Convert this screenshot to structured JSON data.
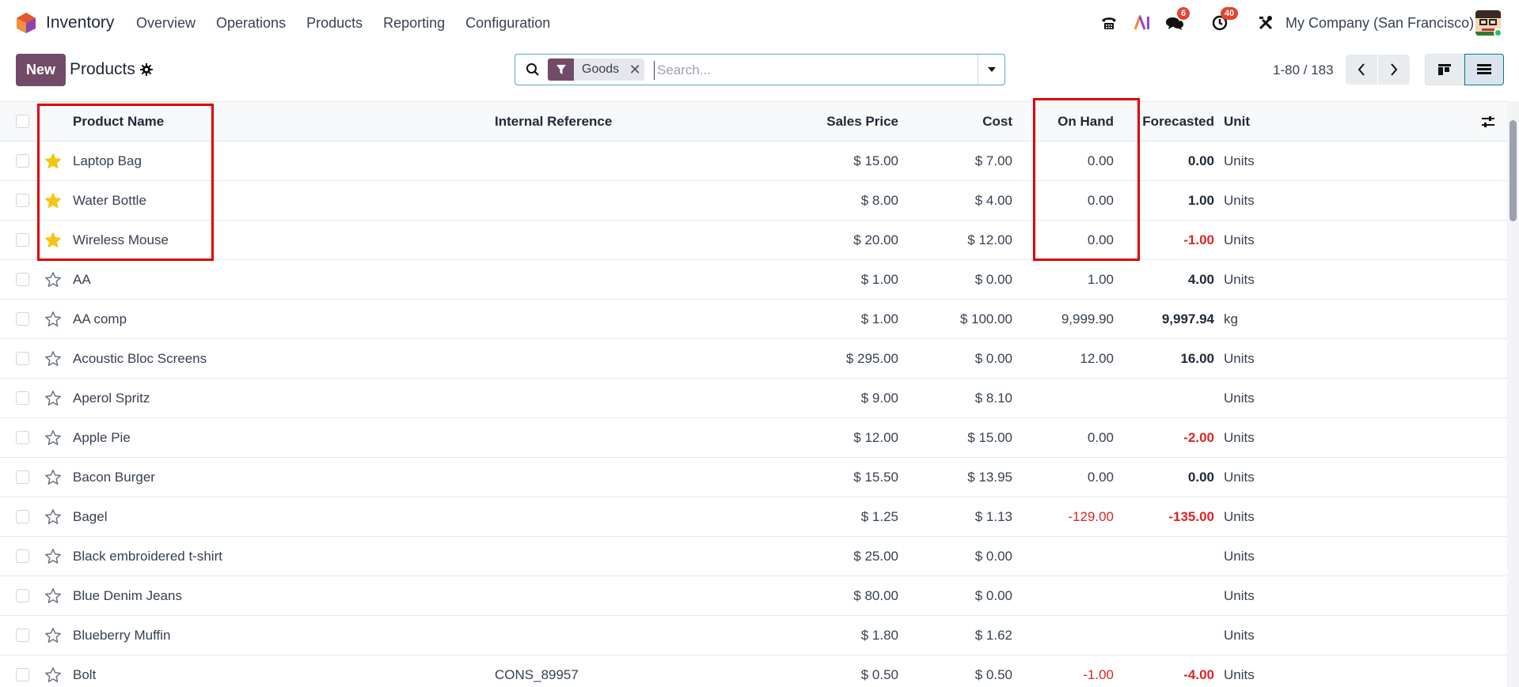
{
  "app": {
    "name": "Inventory"
  },
  "menu": [
    "Overview",
    "Operations",
    "Products",
    "Reporting",
    "Configuration"
  ],
  "systray": {
    "messages_count": "6",
    "activities_count": "40",
    "company": "My Company (San Francisco)"
  },
  "control": {
    "new_label": "New",
    "title": "Products",
    "facet_label": "Goods",
    "search_placeholder": "Search...",
    "pager": "1-80 / 183"
  },
  "columns": {
    "name": "Product Name",
    "ref": "Internal Reference",
    "price": "Sales Price",
    "cost": "Cost",
    "on_hand": "On Hand",
    "forecasted": "Forecasted",
    "unit": "Unit"
  },
  "rows": [
    {
      "starred": true,
      "name": "Laptop Bag",
      "ref": "",
      "price": "$ 15.00",
      "cost": "$ 7.00",
      "on_hand": "0.00",
      "forecasted": "0.00",
      "unit": "Units",
      "hand_neg": false,
      "fore_neg": false
    },
    {
      "starred": true,
      "name": "Water Bottle",
      "ref": "",
      "price": "$ 8.00",
      "cost": "$ 4.00",
      "on_hand": "0.00",
      "forecasted": "1.00",
      "unit": "Units",
      "hand_neg": false,
      "fore_neg": false
    },
    {
      "starred": true,
      "name": "Wireless Mouse",
      "ref": "",
      "price": "$ 20.00",
      "cost": "$ 12.00",
      "on_hand": "0.00",
      "forecasted": "-1.00",
      "unit": "Units",
      "hand_neg": false,
      "fore_neg": true
    },
    {
      "starred": false,
      "name": "AA",
      "ref": "",
      "price": "$ 1.00",
      "cost": "$ 0.00",
      "on_hand": "1.00",
      "forecasted": "4.00",
      "unit": "Units",
      "hand_neg": false,
      "fore_neg": false
    },
    {
      "starred": false,
      "name": "AA comp",
      "ref": "",
      "price": "$ 1.00",
      "cost": "$ 100.00",
      "on_hand": "9,999.90",
      "forecasted": "9,997.94",
      "unit": "kg",
      "hand_neg": false,
      "fore_neg": false
    },
    {
      "starred": false,
      "name": "Acoustic Bloc Screens",
      "ref": "",
      "price": "$ 295.00",
      "cost": "$ 0.00",
      "on_hand": "12.00",
      "forecasted": "16.00",
      "unit": "Units",
      "hand_neg": false,
      "fore_neg": false
    },
    {
      "starred": false,
      "name": "Aperol Spritz",
      "ref": "",
      "price": "$ 9.00",
      "cost": "$ 8.10",
      "on_hand": "",
      "forecasted": "",
      "unit": "Units",
      "hand_neg": false,
      "fore_neg": false
    },
    {
      "starred": false,
      "name": "Apple Pie",
      "ref": "",
      "price": "$ 12.00",
      "cost": "$ 15.00",
      "on_hand": "0.00",
      "forecasted": "-2.00",
      "unit": "Units",
      "hand_neg": false,
      "fore_neg": true
    },
    {
      "starred": false,
      "name": "Bacon Burger",
      "ref": "",
      "price": "$ 15.50",
      "cost": "$ 13.95",
      "on_hand": "0.00",
      "forecasted": "0.00",
      "unit": "Units",
      "hand_neg": false,
      "fore_neg": false
    },
    {
      "starred": false,
      "name": "Bagel",
      "ref": "",
      "price": "$ 1.25",
      "cost": "$ 1.13",
      "on_hand": "-129.00",
      "forecasted": "-135.00",
      "unit": "Units",
      "hand_neg": true,
      "fore_neg": true
    },
    {
      "starred": false,
      "name": "Black embroidered t-shirt",
      "ref": "",
      "price": "$ 25.00",
      "cost": "$ 0.00",
      "on_hand": "",
      "forecasted": "",
      "unit": "Units",
      "hand_neg": false,
      "fore_neg": false
    },
    {
      "starred": false,
      "name": "Blue Denim Jeans",
      "ref": "",
      "price": "$ 80.00",
      "cost": "$ 0.00",
      "on_hand": "",
      "forecasted": "",
      "unit": "Units",
      "hand_neg": false,
      "fore_neg": false
    },
    {
      "starred": false,
      "name": "Blueberry Muffin",
      "ref": "",
      "price": "$ 1.80",
      "cost": "$ 1.62",
      "on_hand": "",
      "forecasted": "",
      "unit": "Units",
      "hand_neg": false,
      "fore_neg": false
    },
    {
      "starred": false,
      "name": "Bolt",
      "ref": "CONS_89957",
      "price": "$ 0.50",
      "cost": "$ 0.50",
      "on_hand": "-1.00",
      "forecasted": "-4.00",
      "unit": "Units",
      "hand_neg": true,
      "fore_neg": true
    }
  ],
  "colors": {
    "brand": "#714b67",
    "danger": "#dc2626",
    "star": "#f3c613",
    "highlight": "#e00000"
  }
}
